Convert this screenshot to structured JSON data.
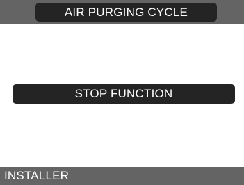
{
  "header": {
    "title": "AIR PURGING CYCLE"
  },
  "main": {
    "action_label": "STOP FUNCTION"
  },
  "footer": {
    "label": "INSTALLER"
  },
  "colors": {
    "bar_background": "#646464",
    "pill_background": "#242424",
    "screen_background": "#ffffff",
    "text": "#ffffff"
  }
}
